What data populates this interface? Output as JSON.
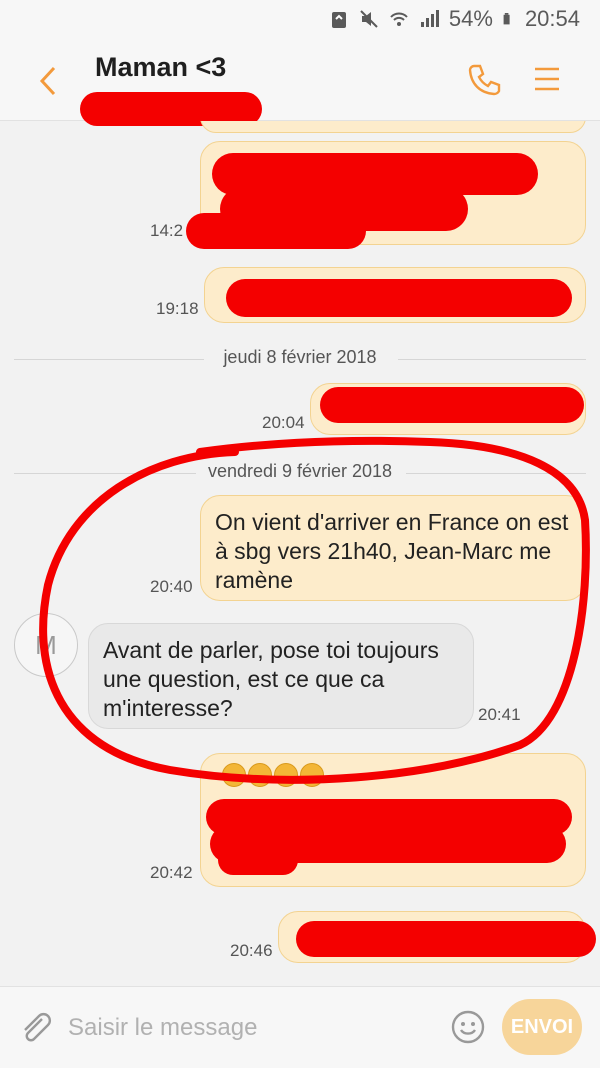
{
  "status_bar": {
    "battery": "54%",
    "time": "20:54"
  },
  "header": {
    "contact_name": "Maman <3"
  },
  "messages": [
    {
      "time": "14:2"
    },
    {
      "time": "19:18"
    },
    {
      "time": "20:04"
    },
    {
      "time": "20:40",
      "text": "On vient d'arriver en France on est à sbg vers 21h40, Jean-Marc me ramène"
    },
    {
      "time": "20:41",
      "text": "Avant de parler, pose toi toujours une question, est ce que ca m'interesse?",
      "avatar_letter": "M"
    },
    {
      "time": "20:42"
    },
    {
      "time": "20:46"
    }
  ],
  "date_separators": [
    "jeudi 8 février 2018",
    "vendredi 9 février 2018"
  ],
  "input": {
    "placeholder": "Saisir le message",
    "send_label": "ENVOI"
  },
  "colors": {
    "accent": "#f39a3c",
    "bubble_out": "#fdeccb",
    "bubble_in": "#e9e9e9",
    "redaction": "#f40000"
  },
  "icons": [
    "recycle-icon",
    "mute-icon",
    "wifi-icon",
    "signal-icon",
    "battery-icon",
    "back-arrow-icon",
    "phone-icon",
    "menu-icon",
    "paperclip-icon",
    "smiley-icon"
  ]
}
